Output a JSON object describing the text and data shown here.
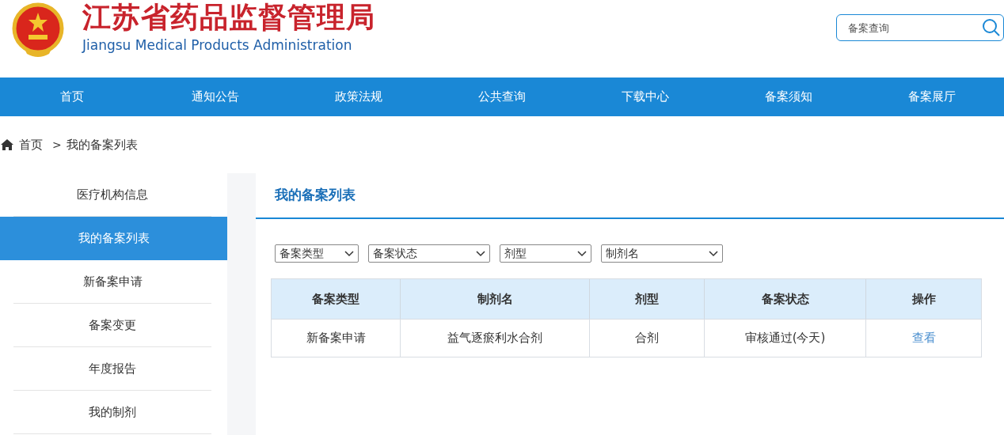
{
  "header": {
    "title": "江苏省药品监督管理局",
    "subtitle": "Jiangsu Medical Products Administration",
    "search": {
      "placeholder": "备案查询"
    }
  },
  "nav": [
    {
      "label": "首页"
    },
    {
      "label": "通知公告"
    },
    {
      "label": "政策法规"
    },
    {
      "label": "公共查询"
    },
    {
      "label": "下载中心"
    },
    {
      "label": "备案须知"
    },
    {
      "label": "备案展厅"
    }
  ],
  "breadcrumb": {
    "home": "首页",
    "separator": ">",
    "current": "我的备案列表"
  },
  "sidebar": {
    "items": [
      {
        "label": "医疗机构信息",
        "selected": false
      },
      {
        "label": "我的备案列表",
        "selected": true
      },
      {
        "label": "新备案申请",
        "selected": false
      },
      {
        "label": "备案变更",
        "selected": false
      },
      {
        "label": "年度报告",
        "selected": false
      },
      {
        "label": "我的制剂",
        "selected": false
      }
    ]
  },
  "main": {
    "title": "我的备案列表",
    "filters": [
      {
        "value": "备案类型"
      },
      {
        "value": "备案状态"
      },
      {
        "value": "剂型"
      },
      {
        "value": "制剂名"
      }
    ],
    "table": {
      "columns": [
        "备案类型",
        "制剂名",
        "剂型",
        "备案状态",
        "操作"
      ],
      "rows": [
        {
          "cells": [
            "新备案申请",
            "益气逐瘀利水合剂",
            "合剂",
            "审核通过(今天)"
          ],
          "action": "查看"
        }
      ]
    }
  }
}
